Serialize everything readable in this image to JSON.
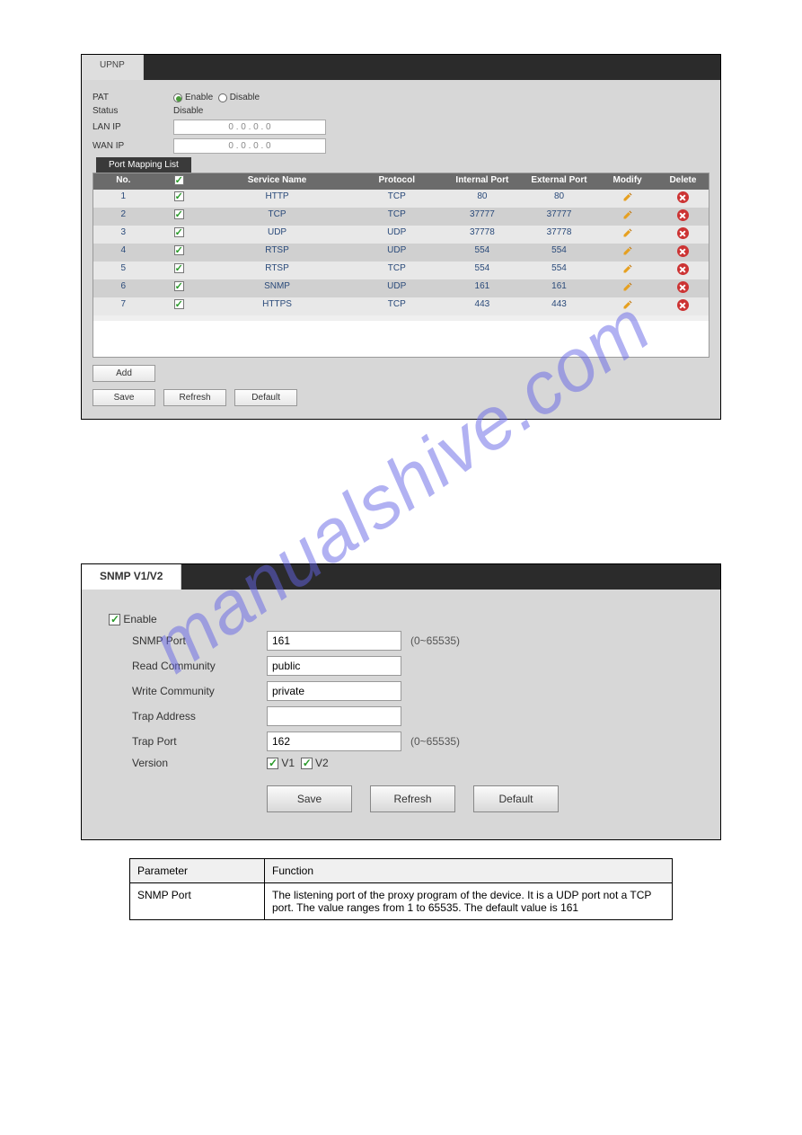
{
  "watermark": "manualshive.com",
  "upnp": {
    "tab": "UPNP",
    "labels": {
      "pat": "PAT",
      "status": "Status",
      "lan": "LAN IP",
      "wan": "WAN IP"
    },
    "radio_enable": "Enable",
    "radio_disable": "Disable",
    "status_value": "Disable",
    "lan_value": "0 . 0 . 0 . 0",
    "wan_value": "0 . 0 . 0 . 0",
    "pml_title": "Port Mapping List",
    "headers": {
      "no": "No.",
      "chk": "",
      "service": "Service Name",
      "proto": "Protocol",
      "iport": "Internal Port",
      "eport": "External Port",
      "modify": "Modify",
      "del": "Delete"
    },
    "rows": [
      {
        "no": "1",
        "service": "HTTP",
        "proto": "TCP",
        "iport": "80",
        "eport": "80"
      },
      {
        "no": "2",
        "service": "TCP",
        "proto": "TCP",
        "iport": "37777",
        "eport": "37777"
      },
      {
        "no": "3",
        "service": "UDP",
        "proto": "UDP",
        "iport": "37778",
        "eport": "37778"
      },
      {
        "no": "4",
        "service": "RTSP",
        "proto": "UDP",
        "iport": "554",
        "eport": "554"
      },
      {
        "no": "5",
        "service": "RTSP",
        "proto": "TCP",
        "iport": "554",
        "eport": "554"
      },
      {
        "no": "6",
        "service": "SNMP",
        "proto": "UDP",
        "iport": "161",
        "eport": "161"
      },
      {
        "no": "7",
        "service": "HTTPS",
        "proto": "TCP",
        "iport": "443",
        "eport": "443"
      }
    ],
    "btn_add": "Add",
    "btn_save": "Save",
    "btn_refresh": "Refresh",
    "btn_default": "Default"
  },
  "snmp": {
    "tab": "SNMP V1/V2",
    "enable": "Enable",
    "labels": {
      "port": "SNMP Port",
      "read": "Read Community",
      "write": "Write Community",
      "trap_addr": "Trap Address",
      "trap_port": "Trap Port",
      "version": "Version"
    },
    "port_val": "161",
    "port_hint": "(0~65535)",
    "read_val": "public",
    "write_val": "private",
    "trap_addr_val": "",
    "trap_port_val": "162",
    "trap_port_hint": "(0~65535)",
    "v1": "V1",
    "v2": "V2",
    "btn_save": "Save",
    "btn_refresh": "Refresh",
    "btn_default": "Default"
  },
  "doc_table": {
    "h1": "Parameter",
    "h2": "Function",
    "r1c1": "SNMP Port",
    "r1c2": "The listening port of the proxy program of the device. It is a UDP port not a TCP port. The value ranges from 1 to 65535. The default value is 161"
  }
}
